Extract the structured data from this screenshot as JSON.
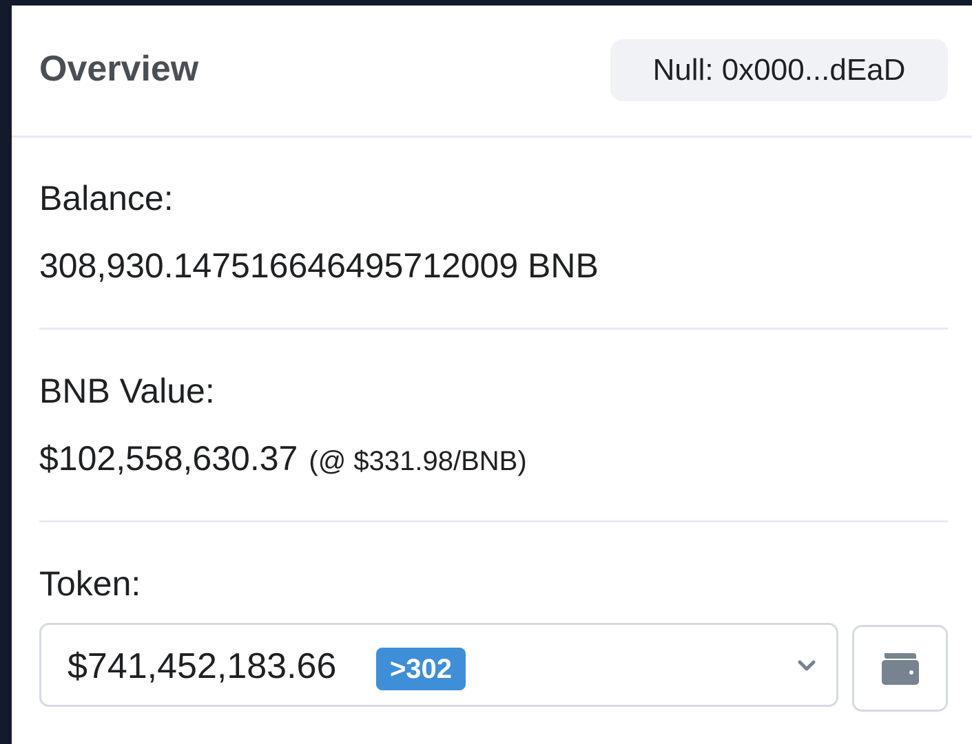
{
  "header": {
    "title": "Overview",
    "address_tag": "Null: 0x000...dEaD"
  },
  "balance": {
    "label": "Balance:",
    "value": "308,930.147516646495712009 BNB"
  },
  "bnb_value": {
    "label": "BNB Value:",
    "value": "$102,558,630.37",
    "rate": "(@ $331.98/BNB)"
  },
  "token": {
    "label": "Token:",
    "value": "$741,452,183.66",
    "badge": ">302"
  },
  "icons": {
    "dropdown": "chevron-down-icon",
    "wallet": "wallet-icon"
  },
  "colors": {
    "badge": "#3e8fd8",
    "icon": "#77838f"
  }
}
